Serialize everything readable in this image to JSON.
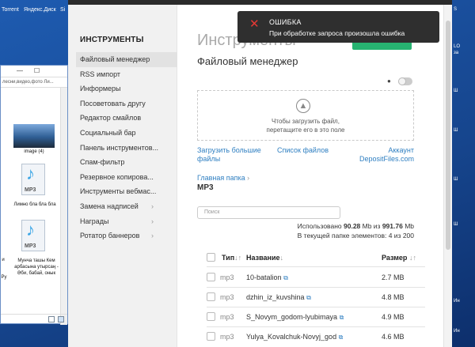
{
  "desktop": {
    "top_labels": [
      "Torrent",
      "Яндекс.Диск",
      "Si"
    ],
    "right_labels": [
      "S",
      "LO",
      "за",
      "Ш",
      "Ш",
      "Ш",
      "Ш",
      "Ин",
      "Ин"
    ]
  },
  "explorer": {
    "minimize": "—",
    "maximize": "☐",
    "address": "лесни,видео,фото Ли...",
    "tile_image_label": "image (4)",
    "file1_label": "Лимно бла бла бла",
    "file2_label": "Мунча ташы Кем арбасына утырсаң - Әби, бабай, онык",
    "file_ext": "MP3",
    "left_label_1": "и",
    "left_label_2": "Ру"
  },
  "sidebar": {
    "title": "ИНСТРУМЕНТЫ",
    "items": [
      {
        "label": "Файловый менеджер",
        "active": true,
        "chevron": false
      },
      {
        "label": "RSS импорт",
        "active": false,
        "chevron": false
      },
      {
        "label": "Информеры",
        "active": false,
        "chevron": false
      },
      {
        "label": "Посоветовать другу",
        "active": false,
        "chevron": false
      },
      {
        "label": "Редактор смайлов",
        "active": false,
        "chevron": false
      },
      {
        "label": "Социальный бар",
        "active": false,
        "chevron": false
      },
      {
        "label": "Панель инструментов...",
        "active": false,
        "chevron": false
      },
      {
        "label": "Спам-фильтр",
        "active": false,
        "chevron": false
      },
      {
        "label": "Резервное копирова...",
        "active": false,
        "chevron": false
      },
      {
        "label": "Инструменты вебмас...",
        "active": false,
        "chevron": false
      },
      {
        "label": "Замена надписей",
        "active": false,
        "chevron": true
      },
      {
        "label": "Награды",
        "active": false,
        "chevron": true
      },
      {
        "label": "Ротатор баннеров",
        "active": false,
        "chevron": true
      }
    ]
  },
  "content": {
    "big_title": "Инструменты",
    "sub_title": "Файловый менеджер",
    "drop_icon": "▲",
    "dropzone_line1": "Чтобы загрузить файл,",
    "dropzone_line2": "перетащите его в это поле",
    "link_upload_large": "Загрузить большие файлы",
    "link_file_list": "Список файлов",
    "link_account": "Аккаунт DepositFiles.com",
    "crumb_home": "Главная папка",
    "crumb_chevron": "›",
    "folder": "MP3",
    "search_placeholder": "Поиск",
    "usage_prefix": "Использовано ",
    "usage_used": "90.28",
    "usage_mid": " Mb из ",
    "usage_total": "991.76",
    "usage_suffix": " Mb",
    "items_prefix": "В текущей папке элементов: ",
    "items_count": "4 из 200"
  },
  "table": {
    "col_type": "Тип",
    "col_type_sort": "↓↑",
    "col_name": "Название",
    "col_name_sort": "↓",
    "col_size": "Размер",
    "col_size_sort": "↓↑",
    "link_icon": "⧉",
    "rows": [
      {
        "type": "mp3",
        "name": "10-batalion",
        "size": "2.7 MB"
      },
      {
        "type": "mp3",
        "name": "dzhin_iz_kuvshina",
        "size": "4.8 MB"
      },
      {
        "type": "mp3",
        "name": "S_Novym_godom-lyubimaya",
        "size": "4.9 MB"
      },
      {
        "type": "mp3",
        "name": "Yulya_Kovalchuk-Novyj_god",
        "size": "4.6 MB"
      }
    ]
  },
  "toast": {
    "icon": "✕",
    "title": "ОШИБКА",
    "message": "При обработке запроса произошла ошибка"
  }
}
